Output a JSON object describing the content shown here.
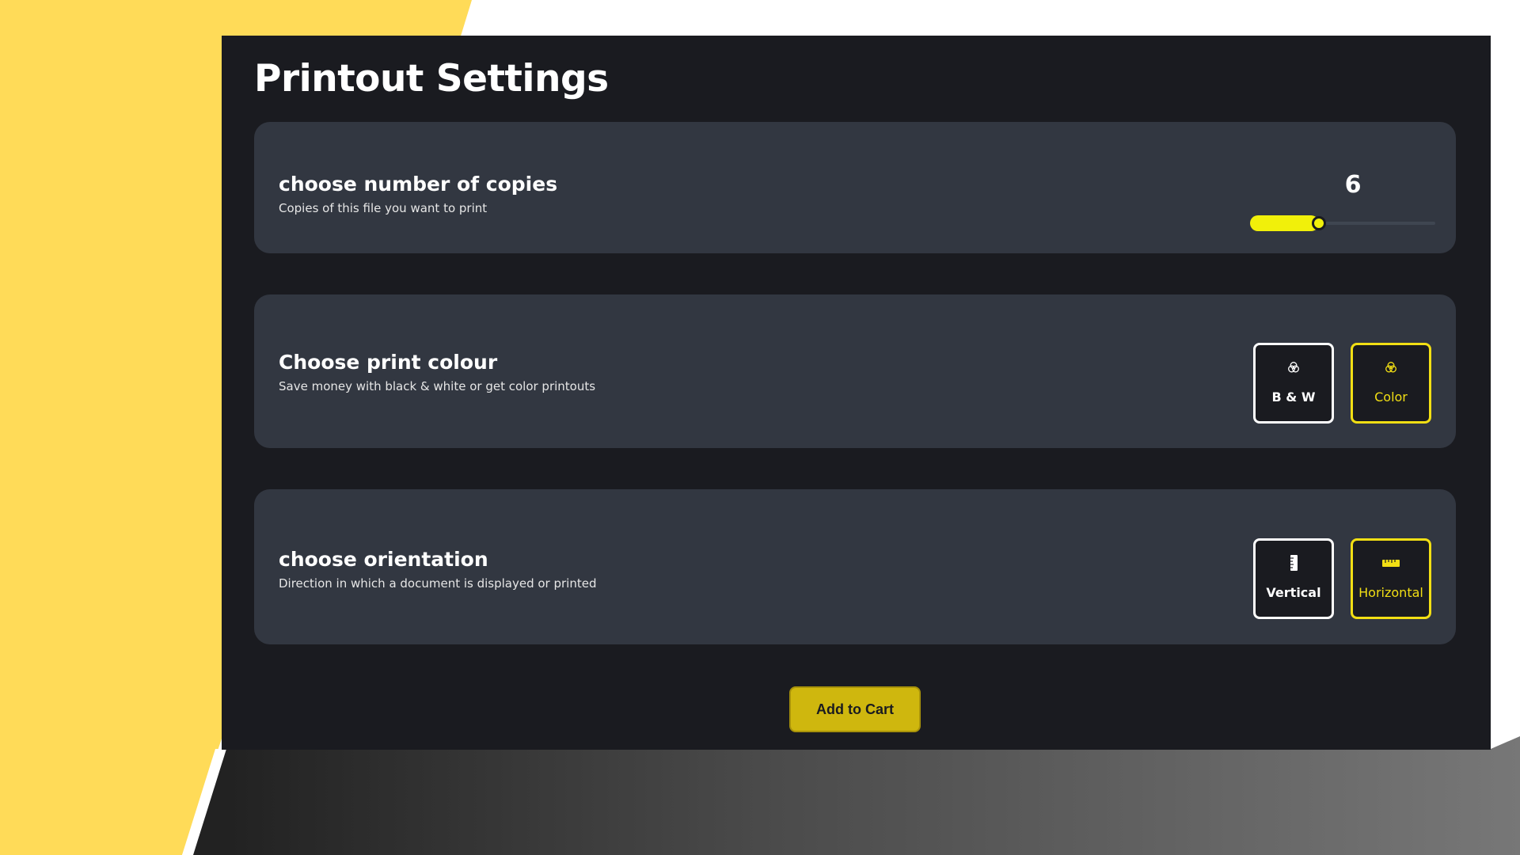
{
  "title": "Printout Settings",
  "copies": {
    "heading": "choose number of copies",
    "subtext": "Copies of this file you want to print",
    "value": "6",
    "slider_fraction": 0.37
  },
  "colour": {
    "heading": "Choose print colour",
    "subtext": "Save money with black & white or get color printouts",
    "options": [
      {
        "label": "B & W",
        "icon": "venn-circles-icon",
        "selected": false
      },
      {
        "label": "Color",
        "icon": "venn-circles-icon",
        "selected": true
      }
    ]
  },
  "orientation": {
    "heading": "choose orientation",
    "subtext": "Direction in which a document is displayed or printed",
    "options": [
      {
        "label": "Vertical",
        "icon": "ruler-vertical-icon",
        "selected": false
      },
      {
        "label": "Horizontal",
        "icon": "ruler-horizontal-icon",
        "selected": true
      }
    ]
  },
  "cart_button": "Add to Cart",
  "colors": {
    "accent": "#f2df14",
    "slider": "#f1f00a",
    "button": "#cfb70e",
    "panel": "#1a1b20",
    "card": "#323741",
    "background_yellow": "#ffdb58"
  }
}
